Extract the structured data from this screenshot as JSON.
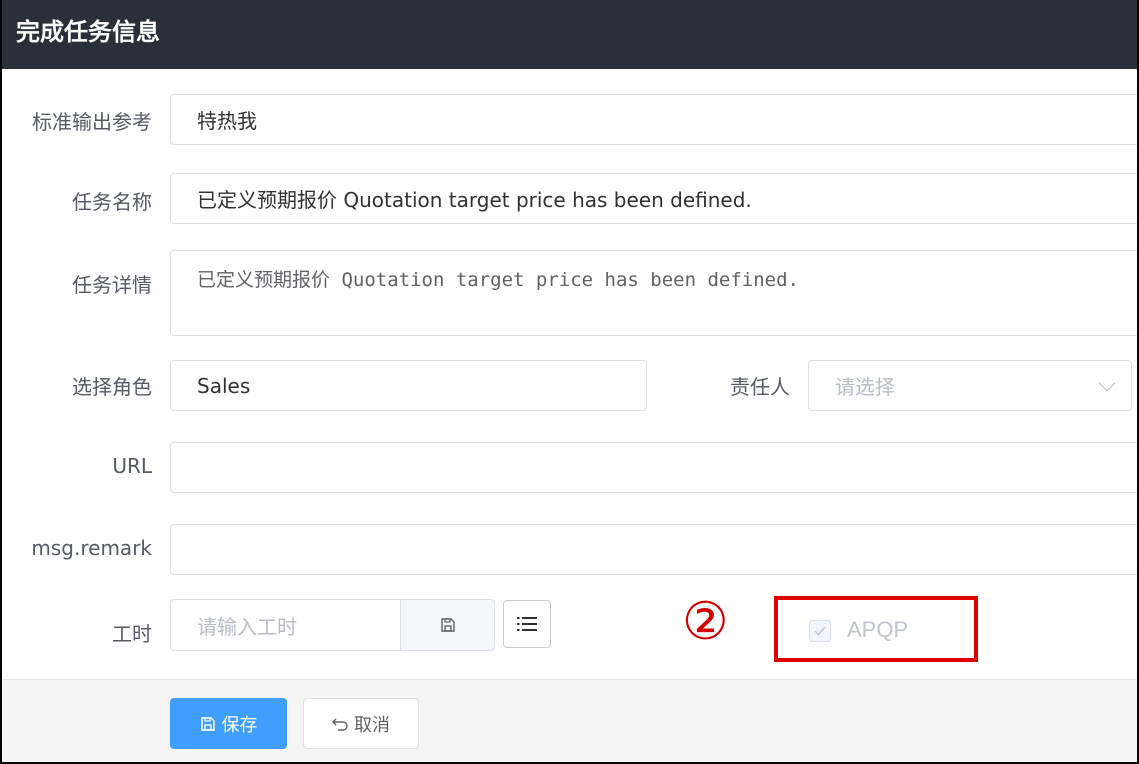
{
  "dialog": {
    "title": "完成任务信息"
  },
  "form": {
    "standard_output": {
      "label": "标准输出参考",
      "value": "特热我"
    },
    "task_name": {
      "label": "任务名称",
      "value": "已定义预期报价 Quotation target price has been defined."
    },
    "task_detail": {
      "label": "任务详情",
      "value": "已定义预期报价 Quotation target price has been defined."
    },
    "role": {
      "label": "选择角色",
      "value": "Sales"
    },
    "owner": {
      "label": "责任人",
      "placeholder": "请选择"
    },
    "url": {
      "label": "URL",
      "value": ""
    },
    "remark": {
      "label": "msg.remark",
      "value": ""
    },
    "hours": {
      "label": "工时",
      "placeholder": "请输入工时"
    }
  },
  "annotation": {
    "marker": "②",
    "color": "#e00000"
  },
  "apqp": {
    "label": "APQP",
    "checked": true,
    "disabled": true
  },
  "footer": {
    "save_label": "保存",
    "cancel_label": "取消"
  },
  "colors": {
    "header_bg": "#2b2f3a",
    "primary": "#409eff"
  },
  "icons": {
    "save": "save-icon",
    "list": "list-icon",
    "undo": "undo-icon",
    "dropdown": "chevron-down-icon"
  }
}
